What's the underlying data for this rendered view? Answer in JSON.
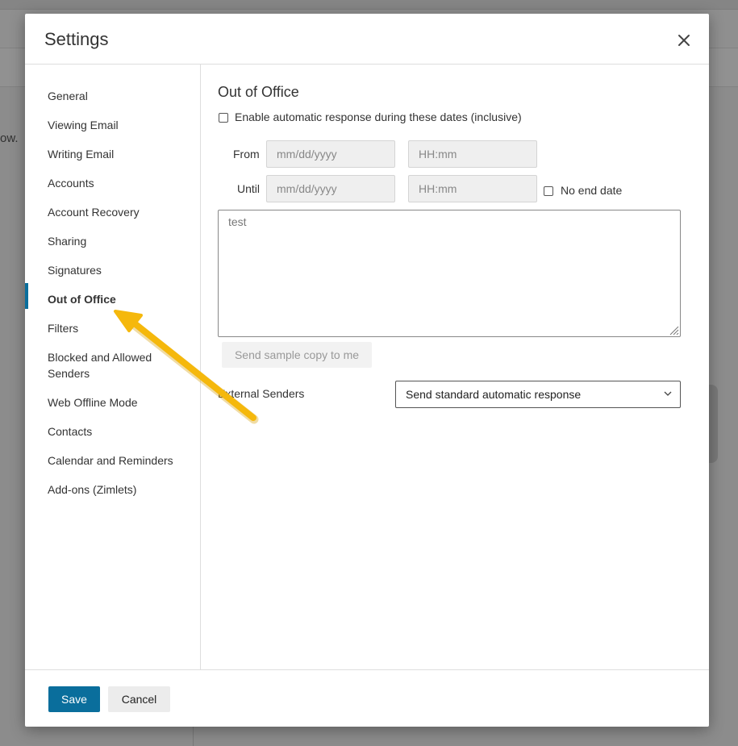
{
  "background": {
    "left_text": "ow."
  },
  "dialog": {
    "title": "Settings",
    "close_icon": "close-icon"
  },
  "sidebar": {
    "items": [
      {
        "label": "General"
      },
      {
        "label": "Viewing Email"
      },
      {
        "label": "Writing Email"
      },
      {
        "label": "Accounts"
      },
      {
        "label": "Account Recovery"
      },
      {
        "label": "Sharing"
      },
      {
        "label": "Signatures"
      },
      {
        "label": "Out of Office",
        "active": true
      },
      {
        "label": "Filters"
      },
      {
        "label": "Blocked and Allowed Senders"
      },
      {
        "label": "Web Offline Mode"
      },
      {
        "label": "Contacts"
      },
      {
        "label": "Calendar and Reminders"
      },
      {
        "label": "Add-ons (Zimlets)"
      }
    ]
  },
  "out_of_office": {
    "title": "Out of Office",
    "enable_label": "Enable automatic response during these dates (inclusive)",
    "enable_checked": false,
    "from_label": "From",
    "until_label": "Until",
    "from_date_placeholder": "mm/dd/yyyy",
    "from_time_placeholder": "HH:mm",
    "until_date_placeholder": "mm/dd/yyyy",
    "until_time_placeholder": "HH:mm",
    "no_end_date_label": "No end date",
    "no_end_date_checked": false,
    "message": "test",
    "sample_copy_button": "Send sample copy to me",
    "external_senders_label": "External Senders",
    "external_senders_value": "Send standard automatic response"
  },
  "footer": {
    "save_label": "Save",
    "cancel_label": "Cancel"
  },
  "colors": {
    "accent": "#0a6e9c",
    "annotation_arrow": "#f5b80c"
  }
}
